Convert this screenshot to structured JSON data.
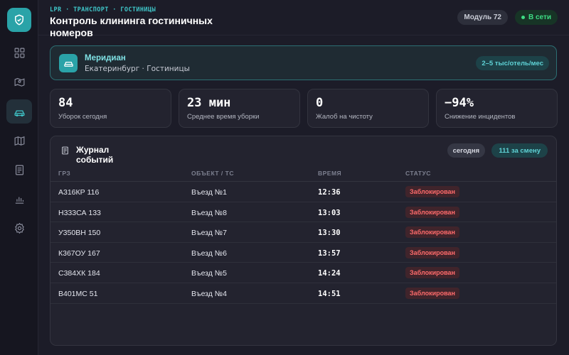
{
  "header": {
    "breadcrumb": "LPR · ТРАНСПОРТ · ГОСТИНИЦЫ",
    "title": "Контроль клининга гостиничных номеров",
    "module_label": "Модуль 72",
    "status_label": "В сети"
  },
  "sidebar": {
    "items": [
      {
        "icon": "dashboard-icon"
      },
      {
        "icon": "map-icon"
      },
      {
        "icon": "car-icon"
      },
      {
        "icon": "map-fold-icon"
      },
      {
        "icon": "document-icon"
      },
      {
        "icon": "chart-icon"
      },
      {
        "icon": "gear-icon"
      }
    ]
  },
  "property": {
    "name": "Меридиан",
    "location": "Екатеринбург · Гостиницы",
    "price_range": "2–5 тыс/отель/мес"
  },
  "kpis": [
    {
      "value": "84",
      "label": "Уборок сегодня"
    },
    {
      "value": "23 мин",
      "label": "Среднее время уборки"
    },
    {
      "value": "0",
      "label": "Жалоб на чистоту"
    },
    {
      "value": "−94%",
      "label": "Снижение инцидентов"
    }
  ],
  "log": {
    "title": "Журнал событий",
    "filter_label": "сегодня",
    "shift_count": "111 за смену",
    "columns": [
      "ГРЗ",
      "ОБЪЕКТ / ТС",
      "ВРЕМЯ",
      "СТАТУС"
    ],
    "rows": [
      {
        "plate": "А316КР 116",
        "object": "Въезд №1",
        "time": "12:36",
        "status": "Заблокирован"
      },
      {
        "plate": "Н333СА 133",
        "object": "Въезд №8",
        "time": "13:03",
        "status": "Заблокирован"
      },
      {
        "plate": "У350ВН 150",
        "object": "Въезд №7",
        "time": "13:30",
        "status": "Заблокирован"
      },
      {
        "plate": "К367ОУ 167",
        "object": "Въезд №6",
        "time": "13:57",
        "status": "Заблокирован"
      },
      {
        "plate": "С384ХК 184",
        "object": "Въезд №5",
        "time": "14:24",
        "status": "Заблокирован"
      },
      {
        "plate": "В401МС 51",
        "object": "Въезд №4",
        "time": "14:51",
        "status": "Заблокирован"
      }
    ]
  },
  "colors": {
    "accent": "#2aa3a8",
    "danger": "#ff6b6b",
    "success": "#3ddc84",
    "background": "#1c1c28"
  }
}
